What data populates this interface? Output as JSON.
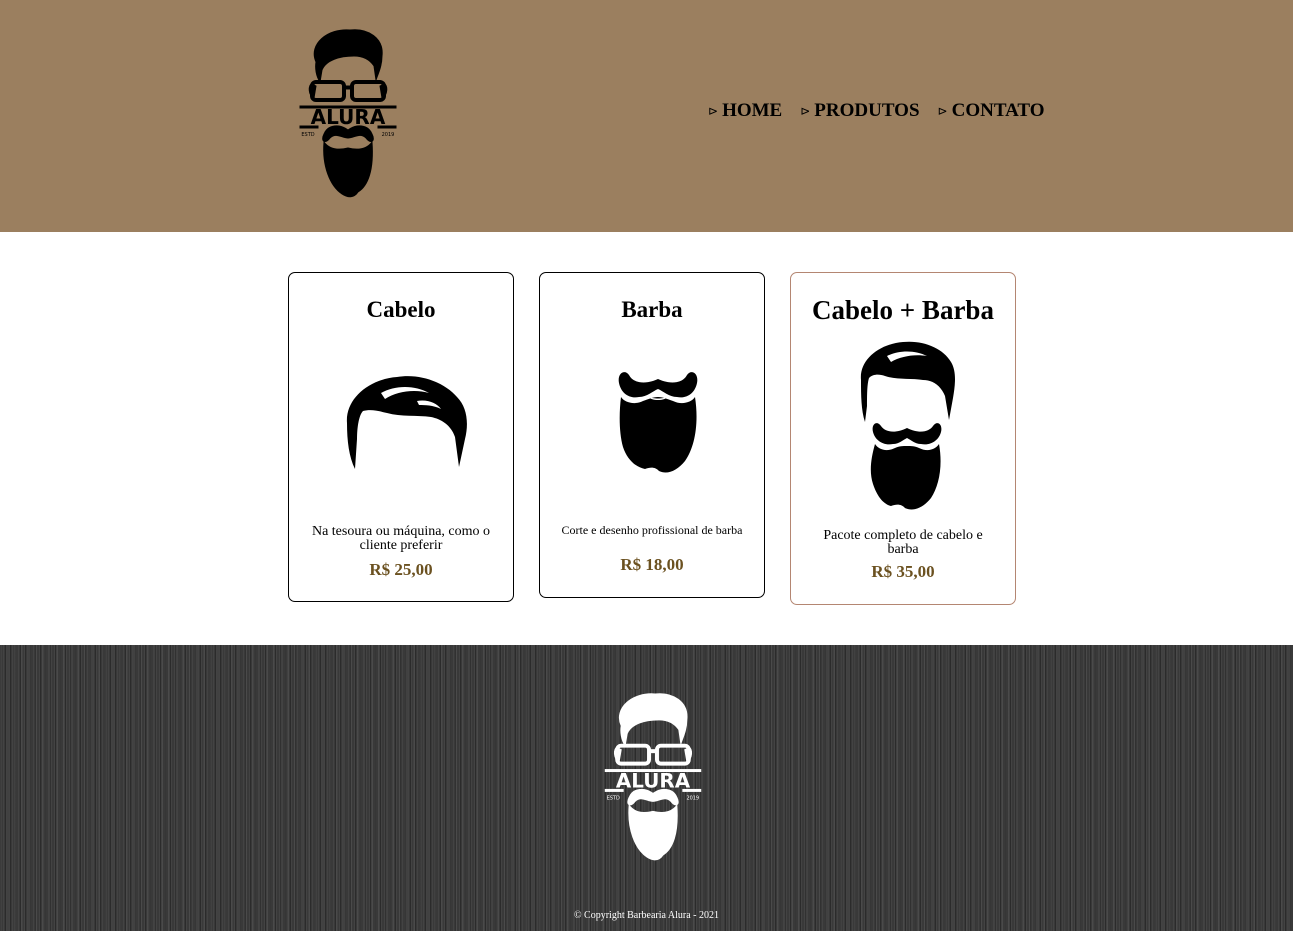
{
  "header": {
    "logo": {
      "icon": "bearded-man-logo-icon",
      "brand": "ALURA",
      "left_text": "ESTD",
      "right_text": "2019"
    },
    "nav": [
      {
        "label": "HOME",
        "icon": "triangle-arrow-icon"
      },
      {
        "label": "PRODUTOS",
        "icon": "triangle-arrow-icon"
      },
      {
        "label": "CONTATO",
        "icon": "triangle-arrow-icon"
      }
    ],
    "background_color": "#9b7f5f"
  },
  "products": [
    {
      "title": "Cabelo",
      "icon": "hair-icon",
      "description": "Na tesoura ou máquina, como o cliente preferir",
      "price": "R$ 25,00"
    },
    {
      "title": "Barba",
      "icon": "beard-icon",
      "description": "Corte e desenho profissional de barba",
      "price": "R$ 18,00"
    },
    {
      "title": "Cabelo + Barba",
      "icon": "hair-and-beard-icon",
      "description": "Pacote completo de cabelo e barba",
      "price": "R$ 35,00"
    }
  ],
  "colors": {
    "price": "#6b5120",
    "highlight_border": "#b48672",
    "footer": "#393939"
  },
  "footer": {
    "logo": {
      "icon": "bearded-man-logo-white-icon",
      "brand": "ALURA",
      "left_text": "ESTD",
      "right_text": "2019"
    },
    "copyright": "© Copyright Barbearia Alura - 2021"
  }
}
